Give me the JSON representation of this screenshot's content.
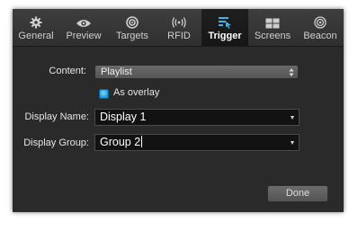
{
  "toolbar": {
    "tabs": [
      {
        "label": "General",
        "icon": "gear-icon"
      },
      {
        "label": "Preview",
        "icon": "eye-icon"
      },
      {
        "label": "Targets",
        "icon": "target-icon"
      },
      {
        "label": "RFID",
        "icon": "rfid-signal-icon"
      },
      {
        "label": "Trigger",
        "icon": "trigger-icon",
        "active": true
      },
      {
        "label": "Screens",
        "icon": "screens-grid-icon"
      },
      {
        "label": "Beacon",
        "icon": "beacon-icon"
      }
    ]
  },
  "form": {
    "content_label": "Content:",
    "content_value": "Playlist",
    "overlay_label": "As overlay",
    "overlay_checked": true,
    "display_name_label": "Display Name:",
    "display_name_value": "Display 1",
    "display_group_label": "Display Group:",
    "display_group_value": "Group 2"
  },
  "footer": {
    "done_label": "Done"
  },
  "colors": {
    "window_bg": "#2a2a2a",
    "accent_blue": "#3ab4ee",
    "active_tab_bg": "#1a1a1a"
  }
}
